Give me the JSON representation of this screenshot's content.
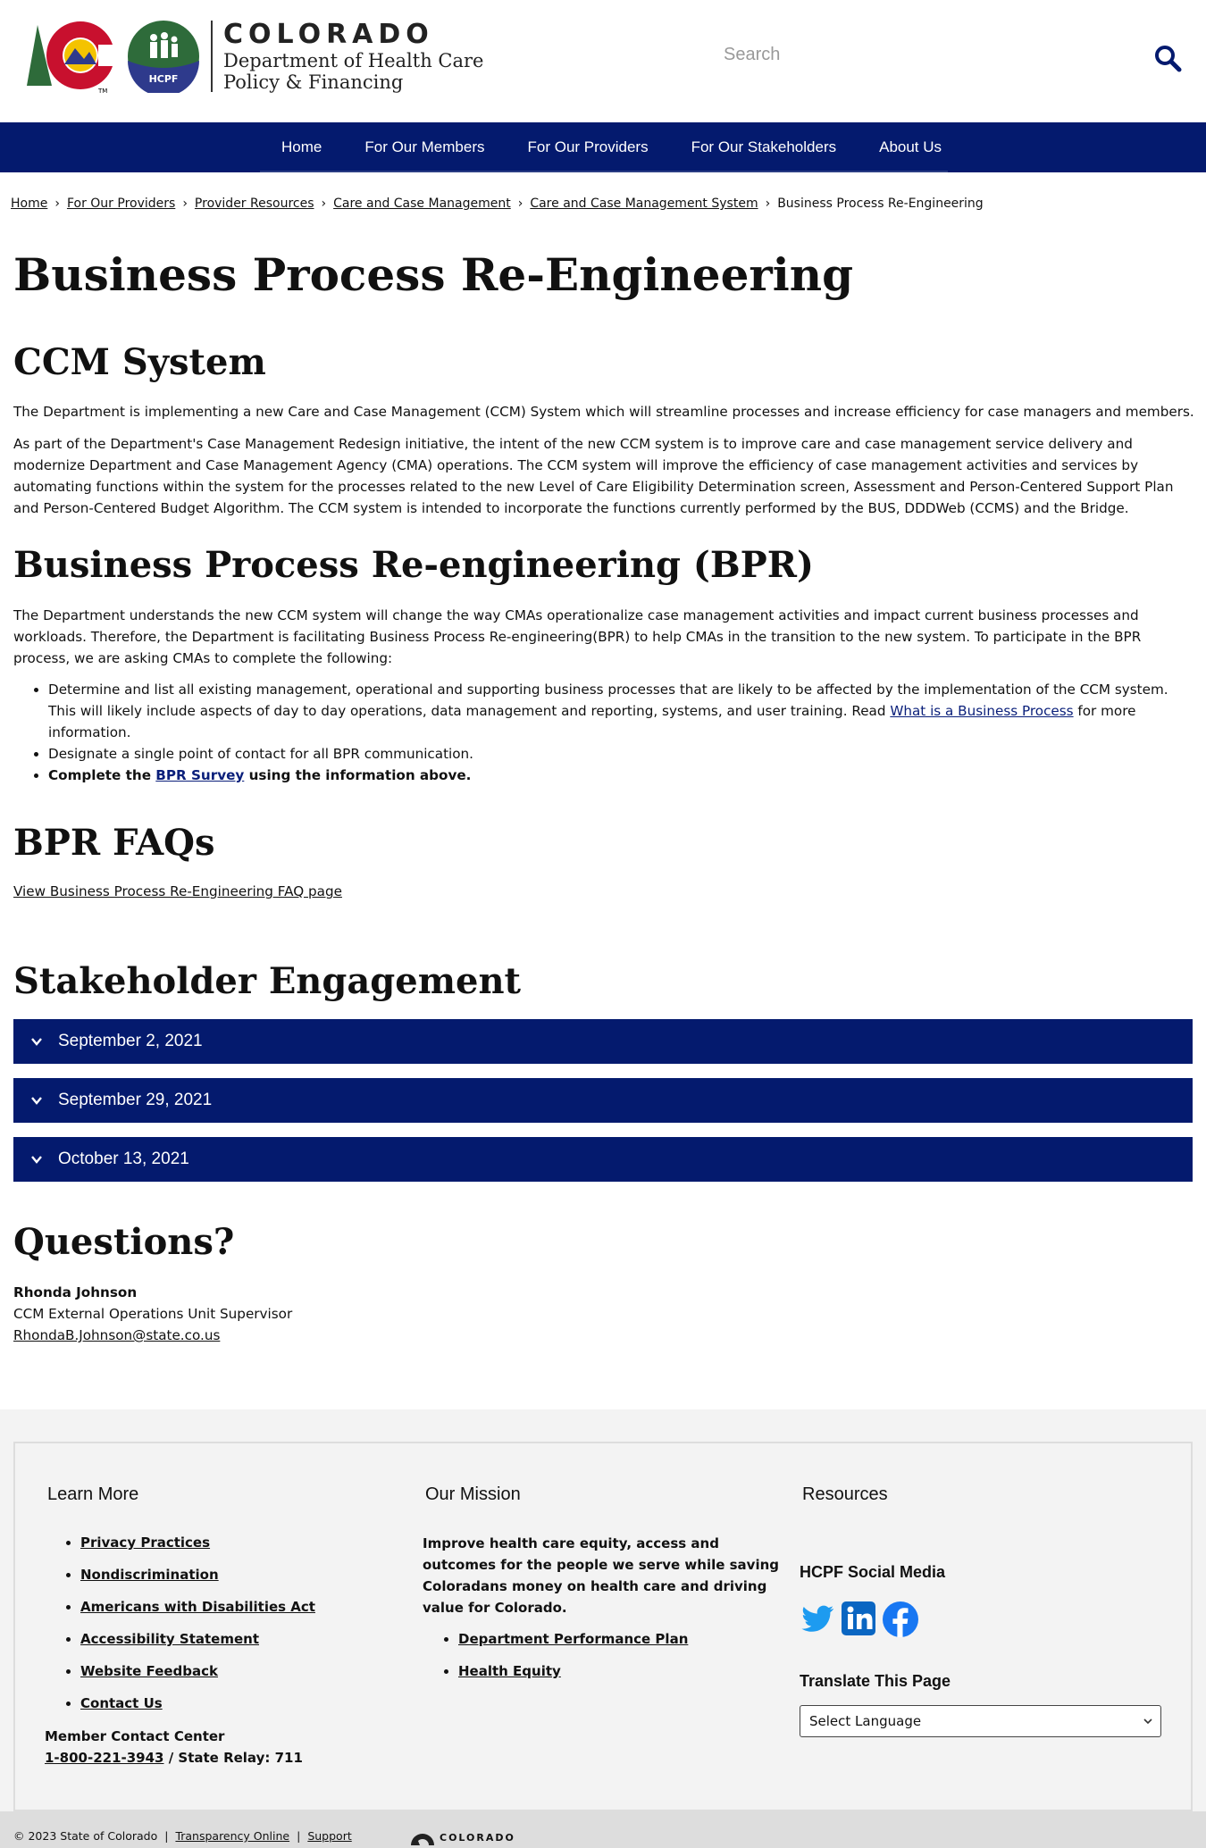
{
  "header": {
    "logo_colorado": "COLORADO",
    "logo_dept_line1": "Department of Health Care",
    "logo_dept_line2": "Policy & Financing",
    "logo_hcpf": "HCPF",
    "logo_tm": "TM",
    "search_placeholder": "Search",
    "search_icon": "search-icon"
  },
  "nav": {
    "items": [
      "Home",
      "For Our Members",
      "For Our Providers",
      "For Our Stakeholders",
      "About Us"
    ]
  },
  "breadcrumb": {
    "items": [
      "Home",
      "For Our Providers",
      "Provider Resources",
      "Care and Case Management",
      "Care and Case Management System"
    ],
    "current": "Business Process Re-Engineering",
    "separator": "›"
  },
  "page": {
    "title": "Business Process Re-Engineering",
    "ccm_heading": "CCM System",
    "ccm_p1": "The Department is implementing a new Care and Case Management (CCM) System which will streamline processes and increase efficiency for case managers and members.",
    "ccm_p2": "As part of the Department's Case Management Redesign initiative, the intent of the new CCM system is to improve care and case management service delivery and modernize Department and Case Management Agency (CMA) operations. The CCM system will improve the efficiency of case management activities and services by automating functions within the system for the processes related to the new Level of Care Eligibility Determination screen, Assessment and Person-Centered Support Plan and Person-Centered Budget Algorithm. The CCM system is intended to incorporate the functions currently performed by the BUS, DDDWeb (CCMS) and the Bridge.",
    "bpr_heading": "Business Process Re-engineering (BPR)",
    "bpr_p1": "The Department understands the new CCM system will change the way CMAs operationalize case management activities and impact current business processes and workloads. Therefore, the Department is facilitating Business Process Re-engineering(BPR) to help CMAs in the transition to the new system. To participate in the BPR process, we are asking CMAs to complete the following:",
    "bullet1_pre": "Determine and list all existing management, operational and supporting business processes that are likely to be affected by the implementation of the CCM system. This will likely include aspects of day to day operations, data management and reporting, systems, and user training. Read ",
    "bullet1_link": "What is a Business Process",
    "bullet1_post": " for more information.",
    "bullet2": "Designate a single point of contact for all BPR communication.",
    "bullet3_pre": "Complete the ",
    "bullet3_link": "BPR Survey",
    "bullet3_post": " using the information above.",
    "faq_heading": "BPR FAQs",
    "faq_link": "View Business Process Re-Engineering FAQ page",
    "stakeholder_heading": "Stakeholder Engagement",
    "accordions": [
      "September 2, 2021",
      "September 29, 2021",
      "October 13, 2021"
    ],
    "questions_heading": "Questions?",
    "contact_name": "Rhonda Johnson",
    "contact_title": "CCM External Operations Unit Supervisor",
    "contact_email": "RhondaB.Johnson@state.co.us"
  },
  "footer": {
    "learn_more_heading": "Learn More",
    "learn_more_links": [
      "Privacy Practices",
      "Nondiscrimination",
      "Americans with Disabilities Act",
      "Accessibility Statement",
      "Website Feedback",
      "Contact Us"
    ],
    "member_contact_label": "Member Contact Center",
    "member_phone": "1-800-221-3943",
    "state_relay": " / State Relay: 711",
    "mission_heading": "Our Mission",
    "mission_text": "Improve health care equity, access and outcomes for the people we serve while saving Coloradans money on health care and driving value for Colorado.",
    "mission_links": [
      "Department Performance Plan",
      "Health Equity"
    ],
    "resources_heading": "Resources",
    "social_heading": "HCPF Social Media",
    "social_icons": [
      "twitter-icon",
      "linkedin-icon",
      "facebook-icon"
    ],
    "translate_heading": "Translate This Page",
    "select_language": "Select Language",
    "copyright": "© 2023 State of Colorado",
    "transparency": "Transparency Online",
    "support": "Support",
    "bottom_logo": "COLORADO"
  },
  "colors": {
    "navy": "#041a6e",
    "link": "#0a1f7a",
    "footer_bg": "#f3f3f3",
    "twitter": "#1d9bf0",
    "linkedin": "#0a66c2",
    "facebook": "#1877f2"
  }
}
